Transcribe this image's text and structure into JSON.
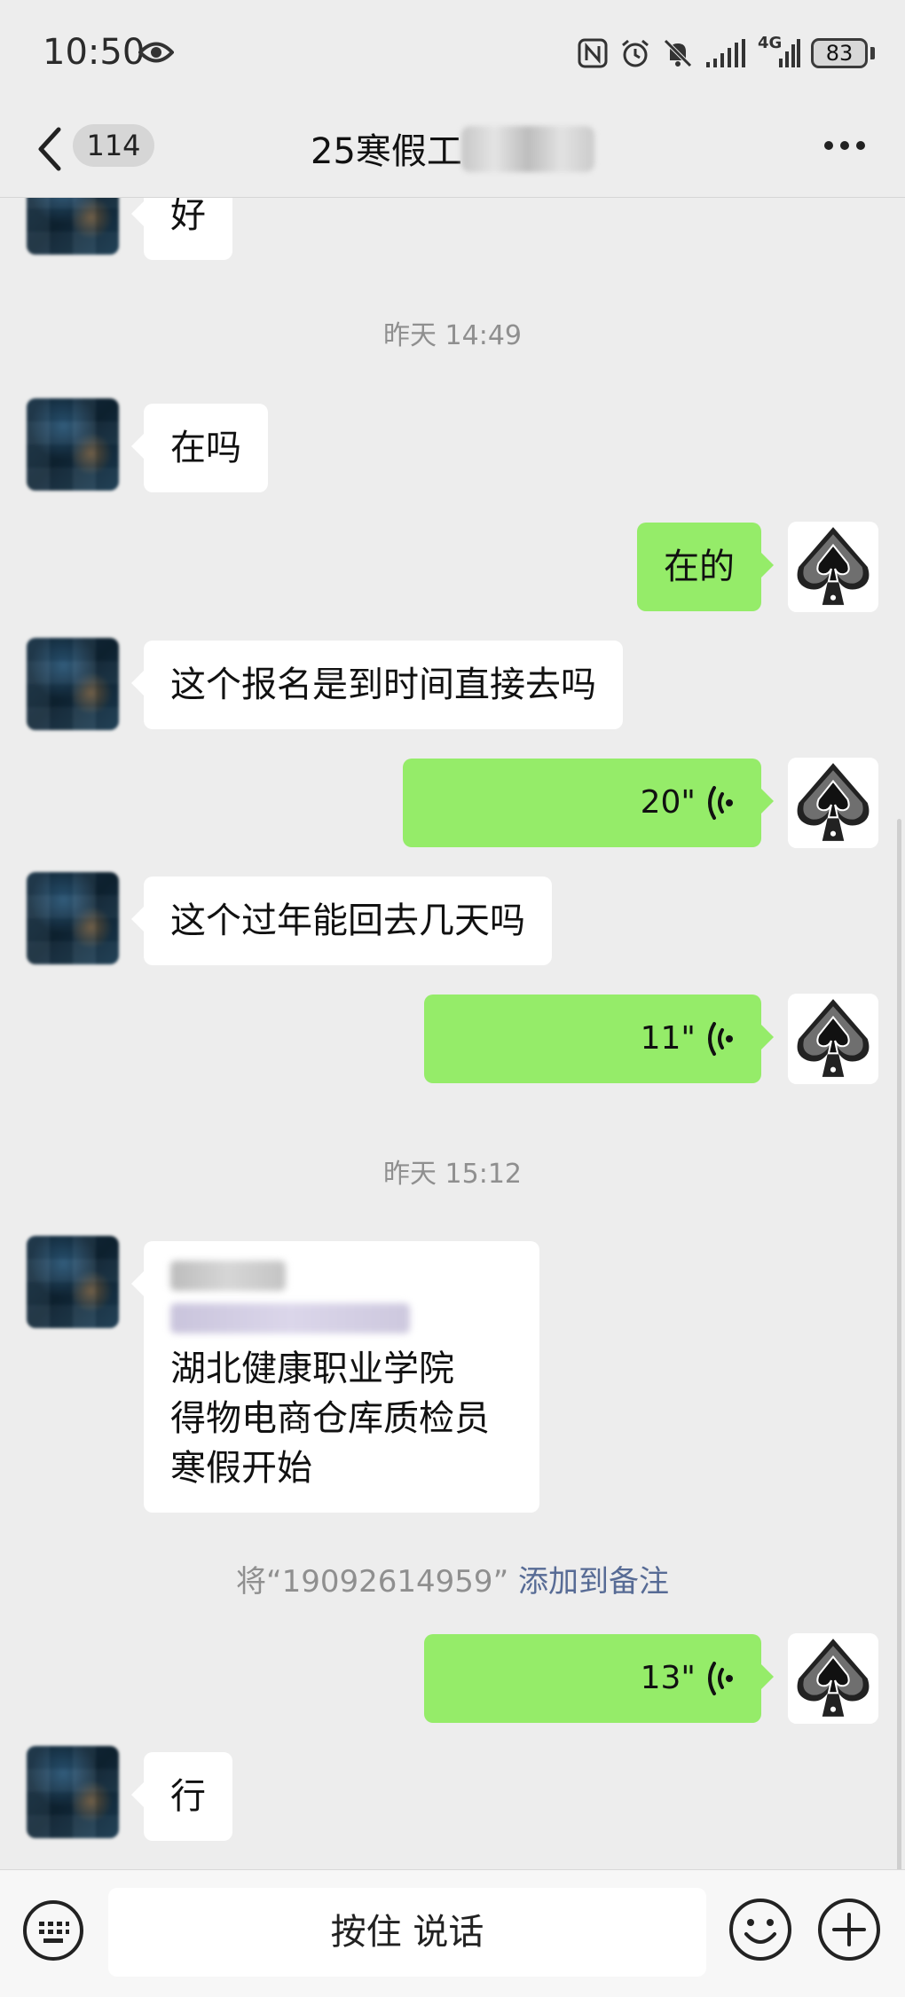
{
  "status": {
    "time": "10:50",
    "network": "4G",
    "battery": "83"
  },
  "header": {
    "back_count": "114",
    "title": "25寒假工"
  },
  "messages": {
    "m0": "好",
    "ts1": "昨天 14:49",
    "m1": "在吗",
    "m2": "在的",
    "m3": "这个报名是到时间直接去吗",
    "m4": "20\"",
    "m5": "这个过年能回去几天吗",
    "m6": "11\"",
    "ts2": "昨天 15:12",
    "m7_line1": "湖北健康职业学院",
    "m7_line2": "得物电商仓库质检员",
    "m7_line3": "寒假开始",
    "note_prefix": "将“19092614959”",
    "note_link": "添加到备注",
    "m8": "13\"",
    "m9": "行"
  },
  "input": {
    "talk_label": "按住 说话"
  },
  "colors": {
    "bubble_self": "#95ec69",
    "bubble_other": "#ffffff",
    "link": "#576b95",
    "background": "#ededed"
  },
  "icons": [
    "eye-icon",
    "nfc-icon",
    "alarm-icon",
    "mute-icon",
    "signal-icon",
    "battery-icon",
    "back-icon",
    "more-icon",
    "voice-icon",
    "keyboard-icon",
    "emoji-icon",
    "plus-icon"
  ]
}
